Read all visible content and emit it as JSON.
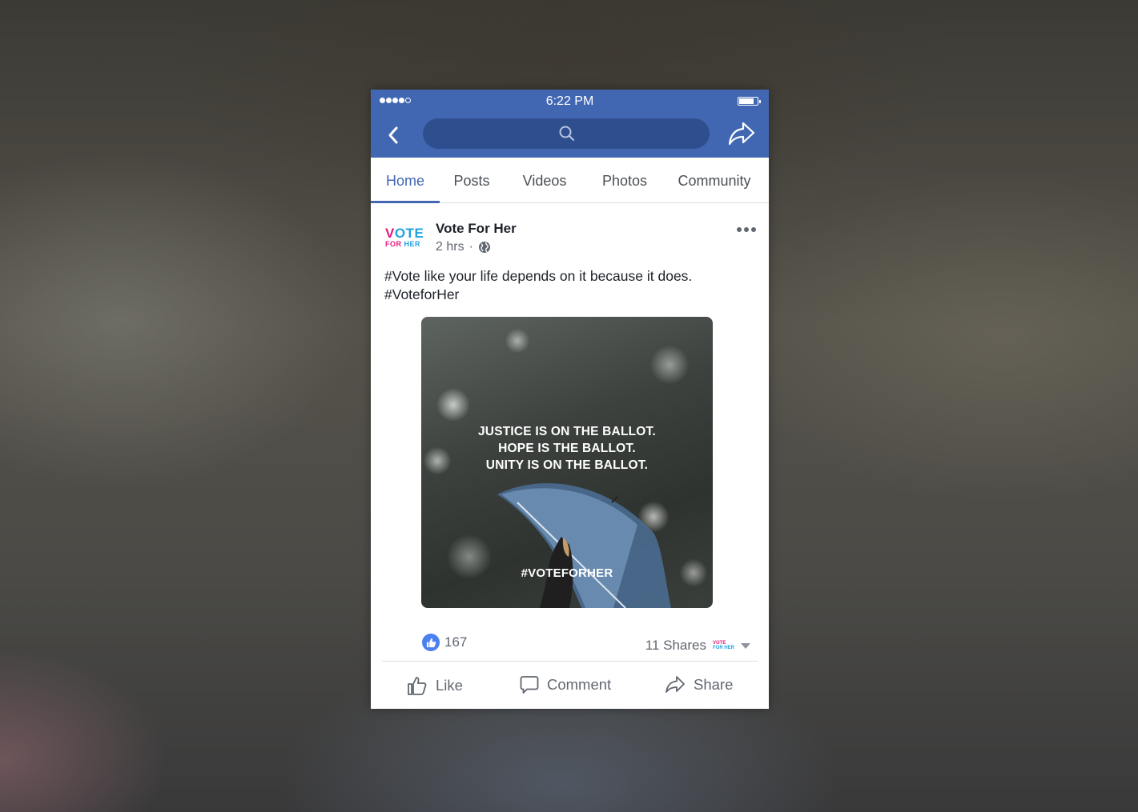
{
  "status_bar": {
    "time": "6:22 PM",
    "signal_bars_filled": 4,
    "signal_bars_total": 5
  },
  "nav": {
    "search_placeholder": ""
  },
  "tabs": [
    {
      "label": "Home",
      "active": true
    },
    {
      "label": "Posts"
    },
    {
      "label": "Videos"
    },
    {
      "label": "Photos"
    },
    {
      "label": "Community"
    }
  ],
  "post": {
    "page_name": "Vote For Her",
    "logo": {
      "line1_pink": "V",
      "line1_blue": "OTE",
      "line2_pink": "FOR",
      "line2_blue": "HER"
    },
    "time": "2 hrs",
    "separator": "·",
    "audience_icon": "globe-icon",
    "text_line1": "#Vote like your life depends on it because it does.",
    "text_line2": "#VoteforHer",
    "image": {
      "line1": "JUSTICE IS ON THE BALLOT.",
      "line2": "HOPE IS THE BALLOT.",
      "line3": "UNITY IS ON THE BALLOT.",
      "hashtag": "#VOTEFORHER"
    },
    "reaction_count": "167",
    "shares_text": "11 Shares",
    "mini_logo": {
      "a": "VOTE",
      "b": "FOR HER"
    }
  },
  "actions": {
    "like": "Like",
    "comment": "Comment",
    "share": "Share"
  },
  "colors": {
    "brand_blue": "#4267b2",
    "search_bg": "#2e4e8e",
    "like_blue": "#4a80f0",
    "logo_pink": "#e6187c",
    "logo_blue": "#1fa2e0"
  }
}
